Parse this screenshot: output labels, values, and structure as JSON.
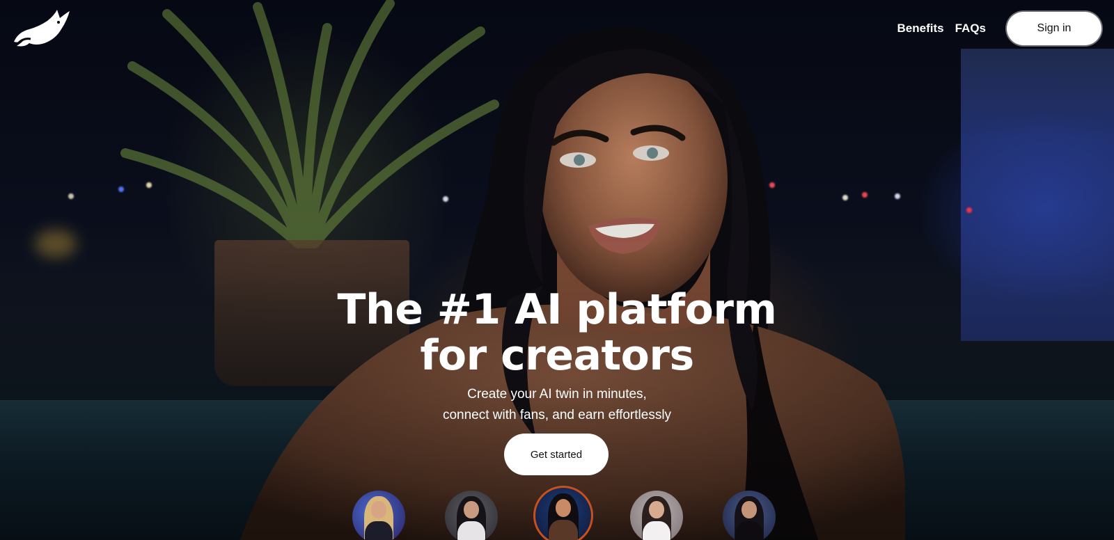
{
  "nav": {
    "logo_icon": "fox-logo-icon",
    "links": [
      {
        "label": "Benefits"
      },
      {
        "label": "FAQs"
      }
    ],
    "signin_label": "Sign in"
  },
  "hero": {
    "headline_line1": "The #1 AI platform",
    "headline_line2": "for creators",
    "subline_line1": "Create your AI twin in minutes,",
    "subline_line2": "connect with fans, and earn effortlessly",
    "cta_label": "Get started"
  },
  "creators": {
    "count": 5,
    "selected_index": 2,
    "accent_color": "#c8501c"
  },
  "colors": {
    "background": "#05070f",
    "button_bg": "#ffffff",
    "button_text": "#111111",
    "text": "#ffffff"
  }
}
